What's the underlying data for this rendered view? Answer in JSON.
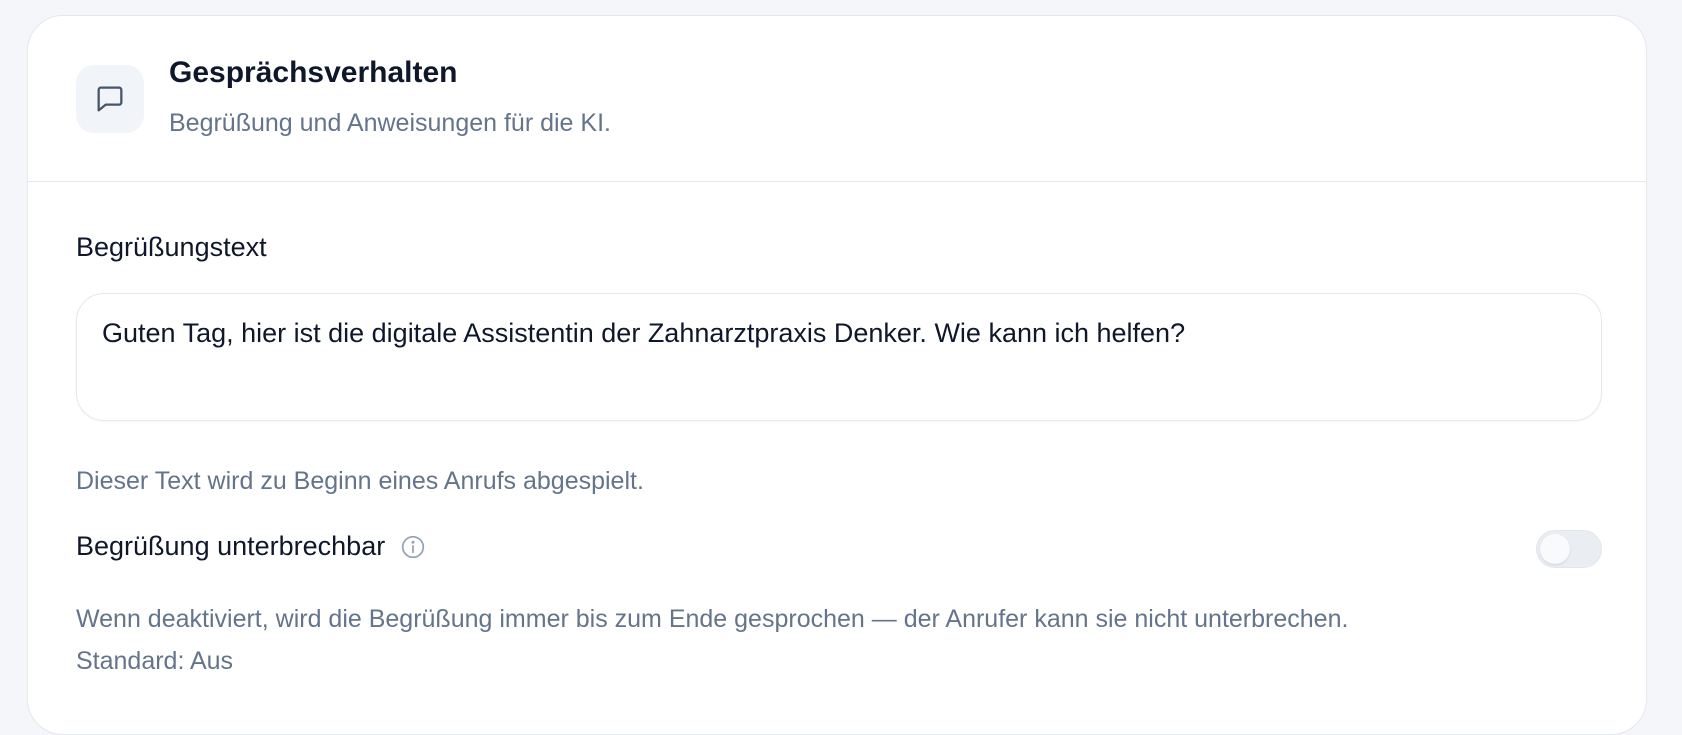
{
  "header": {
    "icon": "chat-bubble-icon",
    "title": "Gesprächsverhalten",
    "subtitle": "Begrüßung und Anweisungen für die KI."
  },
  "greeting": {
    "label": "Begrüßungstext",
    "value": "Guten Tag, hier ist die digitale Assistentin der Zahnarztpraxis Denker. Wie kann ich helfen?",
    "help": "Dieser Text wird zu Beginn eines Anrufs abgespielt."
  },
  "interruptible": {
    "label": "Begrüßung unterbrechbar",
    "info_icon": "info-circle-icon",
    "enabled": false,
    "description": "Wenn deaktiviert, wird die Begrüßung immer bis zum Ende gesprochen — der Anrufer kann sie nicht unterbrechen. Standard: Aus"
  },
  "colors": {
    "background": "#f5f6f9",
    "card": "#ffffff",
    "text_primary": "#0f172a",
    "text_secondary": "#64748b",
    "border": "#e3e7ee",
    "toggle_off": "#eaedf2"
  }
}
